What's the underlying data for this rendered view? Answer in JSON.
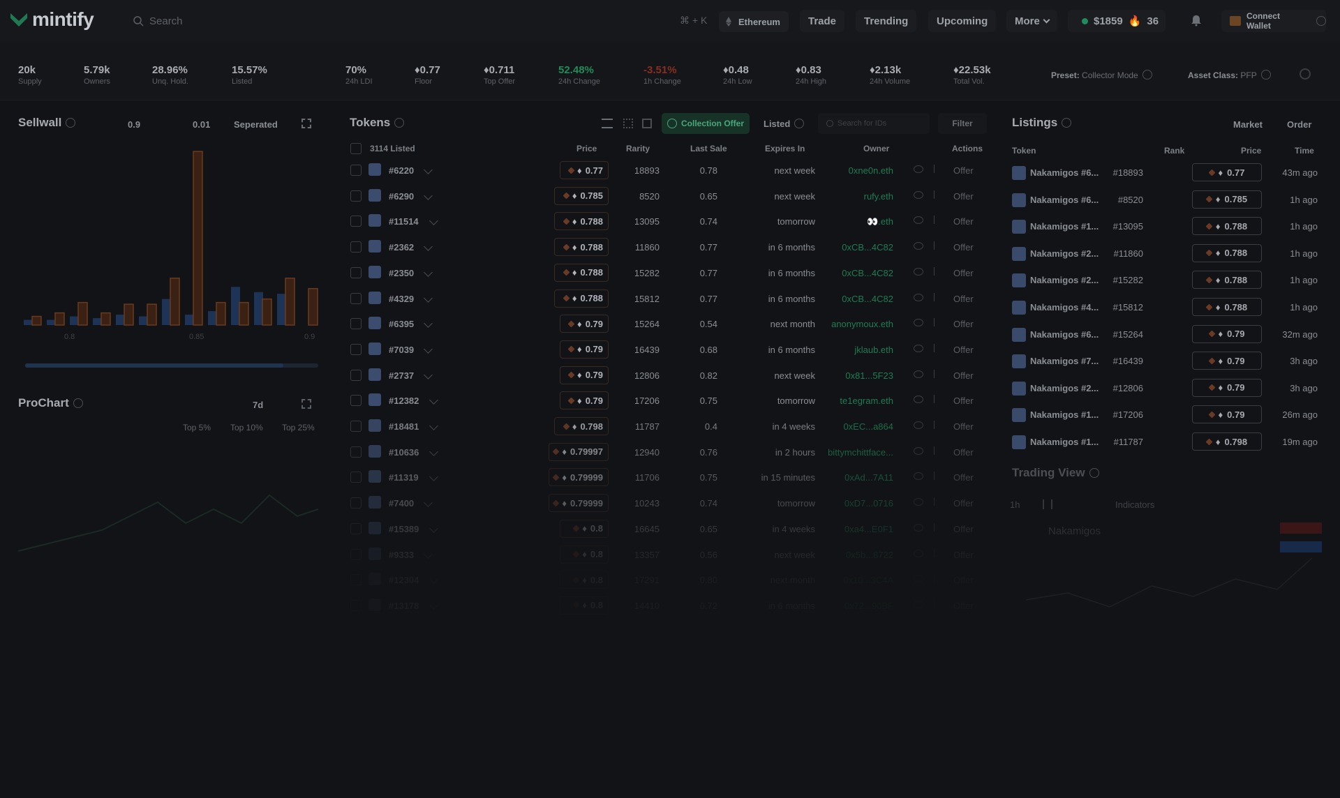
{
  "app": {
    "name": "mintify"
  },
  "topbar": {
    "search_placeholder": "Search",
    "shortcut": "⌘ + K",
    "chain": "Ethereum",
    "nav": [
      "Trade",
      "Trending",
      "Upcoming",
      "More"
    ],
    "gas_price": "$1859",
    "gas_hot": "36",
    "wallet_label": "Connect Wallet"
  },
  "stats": [
    {
      "value": "20k",
      "label": "Supply"
    },
    {
      "value": "5.79k",
      "label": "Owners"
    },
    {
      "value": "28.96%",
      "label": "Unq. Hold."
    },
    {
      "value": "15.57%",
      "label": "Listed"
    },
    {
      "value": "70%",
      "label": "24h LDI"
    },
    {
      "value": "0.77",
      "label": "Floor"
    },
    {
      "value": "0.711",
      "label": "Top Offer"
    },
    {
      "value": "52.48%",
      "label": "24h Change"
    },
    {
      "value": "-3.51%",
      "label": "1h Change"
    },
    {
      "value": "0.48",
      "label": "24h Low"
    },
    {
      "value": "0.83",
      "label": "24h High"
    },
    {
      "value": "2.13k",
      "label": "24h Volume"
    },
    {
      "value": "22.53k",
      "label": "Total Vol."
    }
  ],
  "preset": {
    "label": "Preset:",
    "value": "Collector Mode"
  },
  "asset_class": {
    "label": "Asset Class:",
    "value": "PFP"
  },
  "sellwall": {
    "title": "Sellwall",
    "opt1": "0.9",
    "opt2": "0.01",
    "mode": "Seperated",
    "x_ticks": [
      "0.8",
      "0.85",
      "0.9"
    ],
    "orange_bars": [
      0.05,
      0.07,
      0.13,
      0.07,
      0.12,
      0.12,
      0.27,
      1.0,
      0.13,
      0.13,
      0.15,
      0.27,
      0.21,
      0.17
    ],
    "blue_bars": [
      0.03,
      0.03,
      0.05,
      0.04,
      0.06,
      0.05,
      0.15,
      0.06,
      0.08,
      0.22,
      0.19,
      0.18,
      0.0,
      0.0
    ]
  },
  "prochart": {
    "title": "ProChart",
    "range": "7d",
    "legend": [
      "Top 5%",
      "Top 10%",
      "Top 25%"
    ]
  },
  "tokens": {
    "title": "Tokens",
    "collection_offer": "Collection Offer",
    "listed_label": "Listed",
    "search_placeholder": "Search for IDs",
    "filter": "Filter",
    "listed_count": "3114 Listed",
    "columns": {
      "price": "Price",
      "rarity": "Rarity",
      "last_sale": "Last Sale",
      "expires": "Expires In",
      "owner": "Owner",
      "actions": "Actions"
    },
    "offer_label": "Offer",
    "rows": [
      {
        "id": "#6220",
        "price": "0.77",
        "rarity": "18893",
        "last": "0.78",
        "exp": "next week",
        "owner": "0xne0n.eth"
      },
      {
        "id": "#6290",
        "price": "0.785",
        "rarity": "8520",
        "last": "0.65",
        "exp": "next week",
        "owner": "rufy.eth"
      },
      {
        "id": "#11514",
        "price": "0.788",
        "rarity": "13095",
        "last": "0.74",
        "exp": "tomorrow",
        "owner": "👀.eth"
      },
      {
        "id": "#2362",
        "price": "0.788",
        "rarity": "11860",
        "last": "0.77",
        "exp": "in 6 months",
        "owner": "0xCB...4C82"
      },
      {
        "id": "#2350",
        "price": "0.788",
        "rarity": "15282",
        "last": "0.77",
        "exp": "in 6 months",
        "owner": "0xCB...4C82"
      },
      {
        "id": "#4329",
        "price": "0.788",
        "rarity": "15812",
        "last": "0.77",
        "exp": "in 6 months",
        "owner": "0xCB...4C82"
      },
      {
        "id": "#6395",
        "price": "0.79",
        "rarity": "15264",
        "last": "0.54",
        "exp": "next month",
        "owner": "anonymoux.eth"
      },
      {
        "id": "#7039",
        "price": "0.79",
        "rarity": "16439",
        "last": "0.68",
        "exp": "in 6 months",
        "owner": "jklaub.eth"
      },
      {
        "id": "#2737",
        "price": "0.79",
        "rarity": "12806",
        "last": "0.82",
        "exp": "next week",
        "owner": "0x81...5F23"
      },
      {
        "id": "#12382",
        "price": "0.79",
        "rarity": "17206",
        "last": "0.75",
        "exp": "tomorrow",
        "owner": "te1egram.eth"
      },
      {
        "id": "#18481",
        "price": "0.798",
        "rarity": "11787",
        "last": "0.4",
        "exp": "in 4 weeks",
        "owner": "0xEC...a864"
      },
      {
        "id": "#10636",
        "price": "0.79997",
        "rarity": "12940",
        "last": "0.76",
        "exp": "in 2 hours",
        "owner": "bittymchittface..."
      },
      {
        "id": "#11319",
        "price": "0.79999",
        "rarity": "11706",
        "last": "0.75",
        "exp": "in 15 minutes",
        "owner": "0xAd...7A11"
      },
      {
        "id": "#7400",
        "price": "0.79999",
        "rarity": "10243",
        "last": "0.74",
        "exp": "tomorrow",
        "owner": "0xD7...0716"
      },
      {
        "id": "#15389",
        "price": "0.8",
        "rarity": "16645",
        "last": "0.65",
        "exp": "in 4 weeks",
        "owner": "0xa4...E0F1"
      },
      {
        "id": "#9333",
        "price": "0.8",
        "rarity": "13357",
        "last": "0.56",
        "exp": "next week",
        "owner": "0x5b...8722"
      },
      {
        "id": "#12304",
        "price": "0.8",
        "rarity": "17291",
        "last": "0.80",
        "exp": "next month",
        "owner": "0x10...3C4A"
      },
      {
        "id": "#13178",
        "price": "0.8",
        "rarity": "14410",
        "last": "0.72",
        "exp": "in 6 months",
        "owner": "0x72...90BF"
      }
    ]
  },
  "listings": {
    "title": "Listings",
    "market": "Market",
    "order": "Order",
    "columns": {
      "token": "Token",
      "rank": "Rank",
      "price": "Price",
      "time": "Time"
    },
    "rows": [
      {
        "name": "Nakamigos #6...",
        "rank": "#18893",
        "price": "0.77",
        "time": "43m ago"
      },
      {
        "name": "Nakamigos #6...",
        "rank": "#8520",
        "price": "0.785",
        "time": "1h ago"
      },
      {
        "name": "Nakamigos #1...",
        "rank": "#13095",
        "price": "0.788",
        "time": "1h ago"
      },
      {
        "name": "Nakamigos #2...",
        "rank": "#11860",
        "price": "0.788",
        "time": "1h ago"
      },
      {
        "name": "Nakamigos #2...",
        "rank": "#15282",
        "price": "0.788",
        "time": "1h ago"
      },
      {
        "name": "Nakamigos #4...",
        "rank": "#15812",
        "price": "0.788",
        "time": "1h ago"
      },
      {
        "name": "Nakamigos #6...",
        "rank": "#15264",
        "price": "0.79",
        "time": "32m ago"
      },
      {
        "name": "Nakamigos #7...",
        "rank": "#16439",
        "price": "0.79",
        "time": "3h ago"
      },
      {
        "name": "Nakamigos #2...",
        "rank": "#12806",
        "price": "0.79",
        "time": "3h ago"
      },
      {
        "name": "Nakamigos #1...",
        "rank": "#17206",
        "price": "0.79",
        "time": "26m ago"
      },
      {
        "name": "Nakamigos #1...",
        "rank": "#11787",
        "price": "0.798",
        "time": "19m ago"
      }
    ]
  },
  "trading_view": {
    "title": "Trading View",
    "interval": "1h",
    "indicators": "Indicators",
    "symbol": "Nakamigos"
  }
}
